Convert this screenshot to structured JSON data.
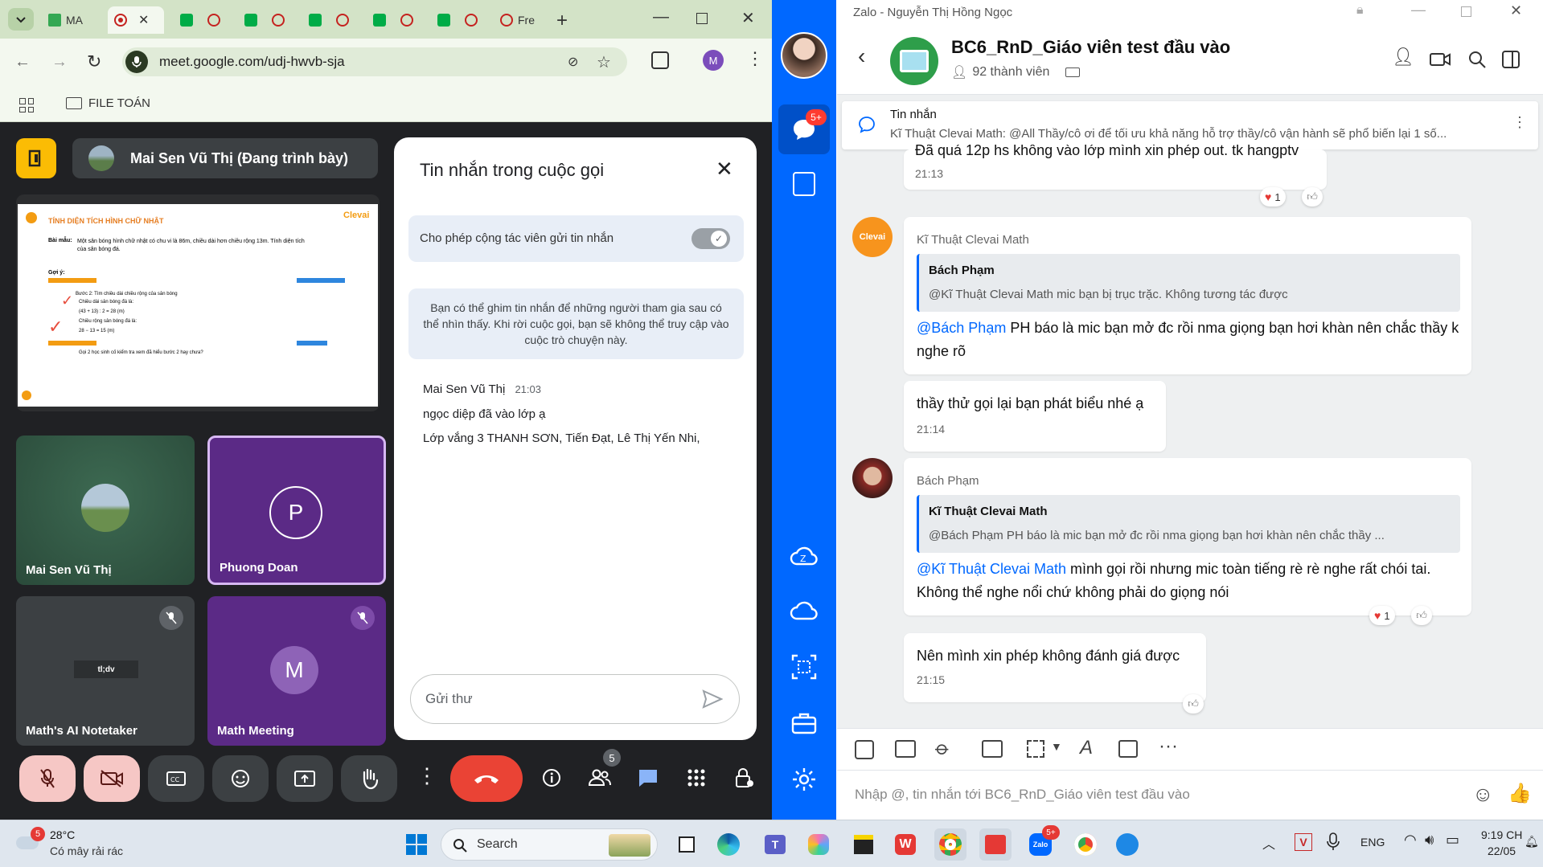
{
  "chrome": {
    "tabs": [
      {
        "label": "MA",
        "icon": "sheets-icon"
      },
      {
        "label": "",
        "icon": "record-icon"
      },
      {
        "label": "",
        "icon": "meet-icon"
      },
      {
        "label": "",
        "icon": "meet-icon"
      },
      {
        "label": "",
        "icon": "meet-icon"
      },
      {
        "label": "",
        "icon": "meet-icon"
      },
      {
        "label": "",
        "icon": "meet-icon"
      },
      {
        "label": "Fre",
        "icon": "record-icon"
      }
    ],
    "url": "meet.google.com/udj-hwvb-sja",
    "profile_initial": "M",
    "bookmark_folder": "FILE TOÁN"
  },
  "meet": {
    "presenter_label": "Mai Sen Vũ Thị (Đang trình bày)",
    "slide": {
      "title": "TÍNH DIỆN TÍCH HÌNH CHỮ NHẬT",
      "brand": "Clevai",
      "problem_label": "Bài mẫu:",
      "problem_text": "Một sân bóng hình chữ nhật có chu vi là 86m, chiều dài hơn chiều rộng 13m. Tính diện tích của sân bóng đá.",
      "hint_label": "Gợi ý:",
      "step_text_1": "Bước 2: Tìm chiều dài chiều rộng của sân bóng",
      "step_text_2": "Chiều dài sân bóng đá là:",
      "step_calc_1": "(43 + 13) : 2 = 28 (m)",
      "step_text_3": "Chiều rộng sân bóng đá là:",
      "step_calc_2": "28 − 13 = 15 (m)",
      "question": "Gọi 2 học sinh cố kiểm tra xem đã hiểu bước 2 hay chưa?"
    },
    "participants": [
      {
        "name": "Mai Sen Vũ Thị",
        "initial": "",
        "muted": false
      },
      {
        "name": "Phuong Doan",
        "initial": "P",
        "muted": false
      },
      {
        "name": "Math's AI Notetaker",
        "initial": "",
        "muted": true,
        "logo": "tl;dv"
      },
      {
        "name": "Math Meeting",
        "initial": "M",
        "muted": true
      }
    ],
    "participant_count": "5",
    "chat": {
      "title": "Tin nhắn trong cuộc gọi",
      "toggle_label": "Cho phép cộng tác viên gửi tin nhắn",
      "info": "Bạn có thể ghim tin nhắn để những người tham gia sau có thể nhìn thấy. Khi rời cuộc gọi, bạn sẽ không thể truy cập vào cuộc trò chuyện này.",
      "sender": "Mai Sen Vũ Thị",
      "time": "21:03",
      "lines": [
        "ngọc diệp đã vào lớp ạ",
        "Lớp vắng 3 THANH SƠN, Tiến Đạt, Lê Thị Yến Nhi,"
      ],
      "input_placeholder": "Gửi thư"
    }
  },
  "zalo": {
    "window_title": "Zalo - Nguyễn Thị Hồng Ngọc",
    "group_name": "BC6_RnD_Giáo viên test đầu vào",
    "member_count": "92 thành viên",
    "unread_badge": "5+",
    "pinned": {
      "label": "Tin nhắn",
      "text": "Kĩ Thuật Clevai Math: @All Thầy/cô ơi để tối ưu khả năng hỗ trợ thầy/cô vận hành sẽ phổ biến lại 1 số..."
    },
    "messages": [
      {
        "text": "Đã quá 12p hs không vào lớp mình xin phép out. tk hangptv",
        "time": "21:13",
        "reaction_count": "1"
      },
      {
        "sender": "Kĩ Thuật Clevai Math",
        "avatar_text": "Clevai",
        "quote_author": "Bách Phạm",
        "quote_text": "@Kĩ Thuật Clevai Math mic bạn bị trục trặc. Không tương tác được",
        "mention": "@Bách Phạm",
        "text": " PH báo là mic bạn mở đc rồi nma giọng bạn hơi khàn nên chắc thầy k nghe rõ"
      },
      {
        "text": "thầy thử gọi lại bạn phát biểu nhé ạ",
        "time": "21:14"
      },
      {
        "sender": "Bách Phạm",
        "quote_author": "Kĩ Thuật Clevai Math",
        "quote_text": "@Bách Phạm PH báo là mic bạn mở đc rồi nma giọng bạn hơi khàn nên chắc thầy ...",
        "mention": "@Kĩ Thuật Clevai Math",
        "text": " mình gọi rồi nhưng mic toàn tiếng rè rè nghe rất chói tai. Không thể nghe nổi chứ không phải do giọng nói",
        "reaction_count": "1"
      },
      {
        "text": "Nên mình xin phép không đánh giá được",
        "time": "21:15"
      }
    ],
    "input_placeholder": "Nhập @, tin nhắn tới BC6_RnD_Giáo viên test đầu vào"
  },
  "taskbar": {
    "weather_temp": "28°C",
    "weather_desc": "Có mây rải rác",
    "weather_badge": "5",
    "search_label": "Search",
    "language": "ENG",
    "time": "9:19 CH",
    "date": "22/05",
    "zalo_badge": "5+"
  },
  "colors": {
    "meet_bg": "#202124",
    "zalo_blue": "#0068ff",
    "hangup_red": "#ea4335",
    "purple_tile": "#5b2a86",
    "chrome_tabbar": "#d3e3c7"
  }
}
